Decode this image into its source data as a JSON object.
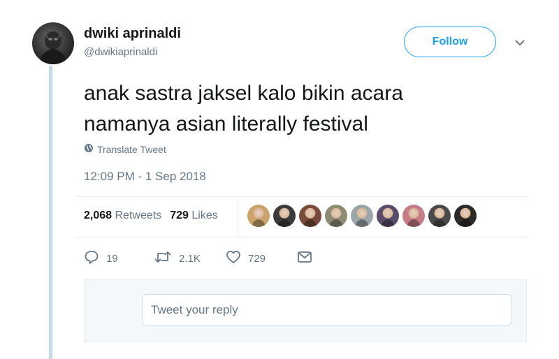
{
  "user": {
    "name": "dwiki aprinaldi",
    "handle": "@dwikiaprinaldi"
  },
  "follow_label": "Follow",
  "tweet": {
    "lines": [
      "anak sastra jaksel kalo bikin acara",
      "namanya asian literally festival"
    ],
    "translate_label": "Translate Tweet",
    "timestamp": "12:09 PM - 1 Sep 2018"
  },
  "stats": {
    "retweets_count": "2,068",
    "retweets_label": "Retweets",
    "likes_count": "729",
    "likes_label": "Likes"
  },
  "likers": [
    {
      "color": "#c9a36a"
    },
    {
      "color": "#3b3b3b"
    },
    {
      "color": "#7a4a3a"
    },
    {
      "color": "#8c8c73"
    },
    {
      "color": "#9aa6a8"
    },
    {
      "color": "#5b4b6b"
    },
    {
      "color": "#c77b85"
    },
    {
      "color": "#4a4a4a"
    },
    {
      "color": "#2f2a2a"
    }
  ],
  "actions": {
    "reply_count": "19",
    "retweet_count": "2.1K",
    "like_count": "729"
  },
  "reply": {
    "placeholder": "Tweet your reply"
  },
  "colors": {
    "accent": "#1da1f2",
    "muted": "#657786",
    "thread_line": "#c4dbee"
  }
}
